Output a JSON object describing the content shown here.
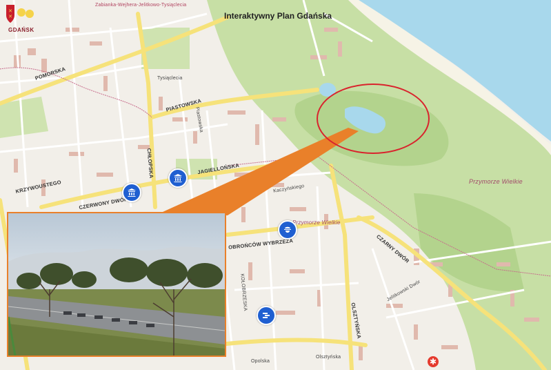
{
  "map": {
    "title": "Interaktywny Plan Gdańska",
    "logo": {
      "text": "GDAŃSK",
      "icon": "gdansk-coat-of-arms-icon"
    },
    "colors": {
      "sea": "#a8d8ec",
      "park": "#c7dfa5",
      "park_dark": "#b3d38d",
      "major_road": "#f6e27a",
      "minor_road": "#ffffff",
      "building": "#e0b9ad",
      "highlight_ring": "#d9232d",
      "callout": "#e9802a",
      "marker": "#1f5fd1"
    },
    "street_labels": [
      "Zabianka-Wejhera-Jelitkowo-Tysiąclecia",
      "POMORSKA",
      "PIASTOWSKA",
      "JAGIELLOŃSKA",
      "KRZYWOUSTEGO",
      "CZERWONY DWÓR",
      "OBROŃCÓW WYBRZEŻA",
      "CZARNY DWÓR",
      "KOŁOBRZESKA",
      "OLSZTYŃSKA",
      "CHŁOPSKA",
      "Kaczyńskiego",
      "Jelitkowski Dwór",
      "Piastowska",
      "Tysiąclecia",
      "Olsztyńska",
      "Opolska"
    ],
    "place_labels": [
      "Przymorze Wielkie",
      "Przymorze Wielkie"
    ],
    "markers": [
      {
        "icon": "museum-icon"
      },
      {
        "icon": "museum-icon"
      },
      {
        "icon": "police-icon"
      },
      {
        "icon": "office-icon"
      }
    ],
    "photo": {
      "subject": "park-view-photo"
    }
  }
}
